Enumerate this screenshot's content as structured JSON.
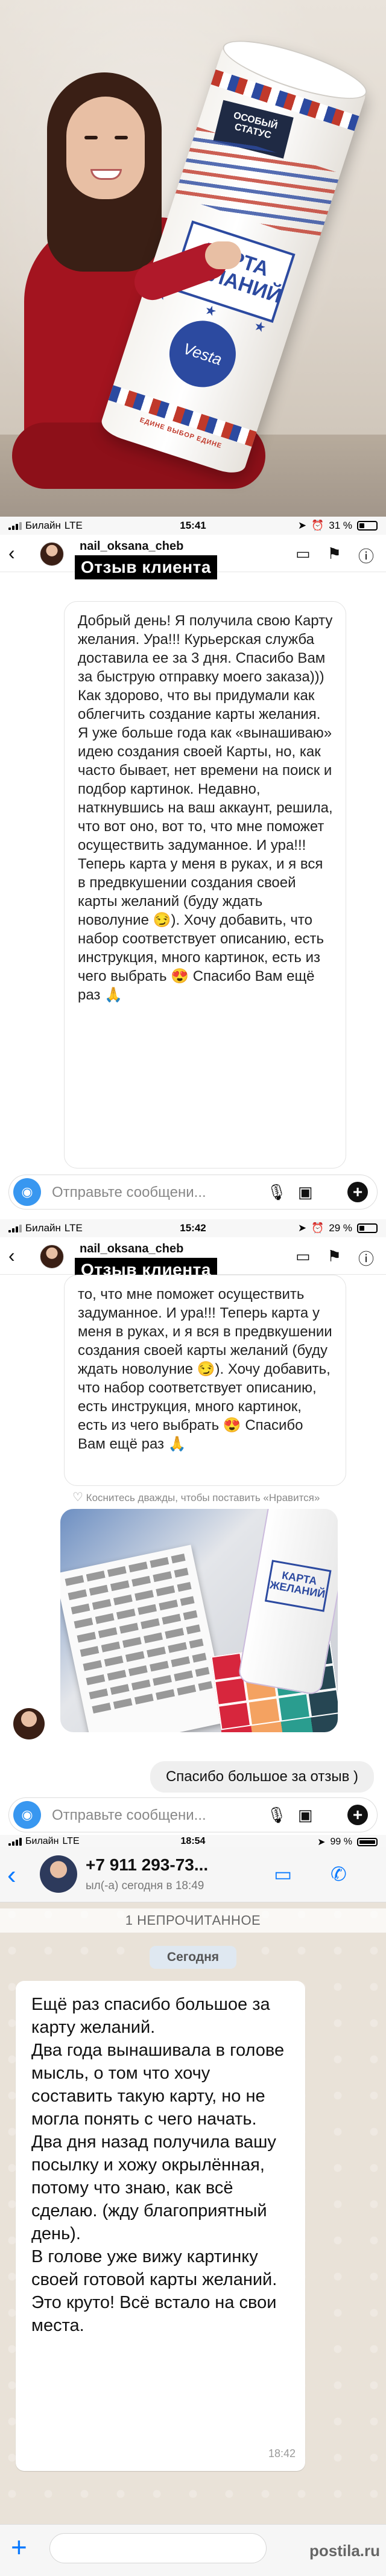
{
  "photo": {
    "tube_badge": "ОСОБЫЙ СТАТУС",
    "tube_title": "КАРТА ЖЕЛАНИЙ",
    "tube_logo": "Vesta",
    "tube_edge_text": "ЕДИНЕ ВЫБОР ЕДИНЕ"
  },
  "screen1": {
    "status": {
      "carrier": "Билайн",
      "network": "LTE",
      "time": "15:41",
      "battery": "31 %",
      "battery_level": 0.31
    },
    "username": "nail_oksana_cheb",
    "banner": "Отзыв клиента",
    "message": "Добрый день! Я получила свою Карту желания. Ура!!! Курьерская служба доставила ее за 3 дня. Спасибо Вам за быструю отправку моего заказа))) Как здорово, что вы придумали как облегчить создание карты желания. Я уже больше года как «вынашиваю» идею создания своей Карты, но, как часто бывает, нет времени на поиск и подбор картинок. Недавно, наткнувшись на ваш аккаунт, решила, что вот оно, вот то, что мне поможет осуществить задуманное. И ура!!! Теперь карта у меня в руках, и я вся в предвкушении создания своей карты желаний (буду ждать новолуние 😏). Хочу добавить, что набор соответствует описанию, есть инструкция, много картинок, есть из чего выбрать 😍 Спасибо Вам ещё раз 🙏",
    "composer_placeholder": "Отправьте сообщени..."
  },
  "screen2": {
    "status": {
      "carrier": "Билайн",
      "network": "LTE",
      "time": "15:42",
      "battery": "29 %",
      "battery_level": 0.29
    },
    "username": "nail_oksana_cheb",
    "banner": "Отзыв клиента",
    "message": "то, что мне поможет осуществить задуманное. И ура!!! Теперь карта у меня в руках, и я вся в предвкушении создания своей карты желаний (буду ждать новолуние 😏). Хочу добавить, что набор соответствует описанию, есть инструкция, много картинок, есть из чего выбрать 😍 Спасибо Вам ещё раз 🙏",
    "like_hint": "Коснитесь дважды, чтобы поставить «Нравится»",
    "photo_tube_title": "КАРТА ЖЕЛАНИЙ",
    "sent_message": "Спасибо большое за отзыв )",
    "composer_placeholder": "Отправьте сообщени..."
  },
  "screen3": {
    "status": {
      "carrier": "Билайн",
      "network": "LTE",
      "time": "18:54",
      "battery": "99 %",
      "battery_level": 0.99
    },
    "contact": "+7 911 293-73...",
    "last_seen": "ыл(-а) сегодня в 18:49",
    "unread": "1 НЕПРОЧИТАННОЕ",
    "date": "Сегодня",
    "message": "Ещё раз спасибо большое за карту желаний.\nДва года вынашивала в голове мысль, о том что хочу составить такую карту, но не могла понять с чего начать.\nДва дня назад получила вашу посылку и хожу окрылённая, потому что знаю, как всё сделаю. (жду благоприятный день).\nВ голове уже вижу картинку своей готовой карты желаний. Это круто! Всё встало на свои места.",
    "message_time": "18:42",
    "watermark": "postila.ru"
  },
  "icons": {
    "back": "chevron-left-icon",
    "video": "video-camera-icon",
    "flag": "flag-icon",
    "info": "info-icon",
    "camera": "camera-icon",
    "mic": "microphone-icon",
    "gallery": "gallery-icon",
    "plus": "plus-icon",
    "call": "phone-icon",
    "heart": "heart-icon"
  }
}
